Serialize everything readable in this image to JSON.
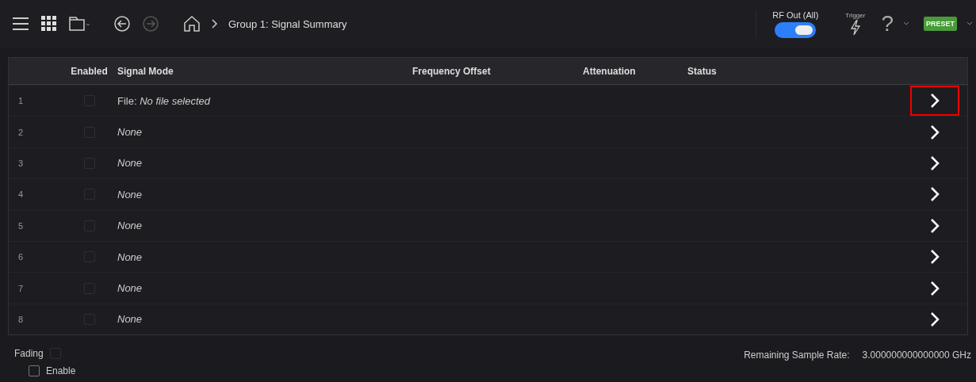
{
  "toolbar": {
    "breadcrumb": "Group 1: Signal Summary",
    "back_disabled": false,
    "forward_disabled": true,
    "rf_out": {
      "label": "RF Out (All)",
      "on": true
    },
    "trigger": {
      "label": "Trigger"
    },
    "help": "?",
    "preset": "PRESET"
  },
  "table": {
    "columns": [
      "Enabled",
      "Signal Mode",
      "Frequency Offset",
      "Attenuation",
      "Status"
    ],
    "rows": [
      {
        "index": "1",
        "enabled": false,
        "mode": "File: *No file selected*",
        "highlighted": true
      },
      {
        "index": "2",
        "enabled": false,
        "mode": "*None*",
        "highlighted": false
      },
      {
        "index": "3",
        "enabled": false,
        "mode": "*None*",
        "highlighted": false
      },
      {
        "index": "4",
        "enabled": false,
        "mode": "*None*",
        "highlighted": false
      },
      {
        "index": "5",
        "enabled": false,
        "mode": "*None*",
        "highlighted": false
      },
      {
        "index": "6",
        "enabled": false,
        "mode": "*None*",
        "highlighted": false
      },
      {
        "index": "7",
        "enabled": false,
        "mode": "*None*",
        "highlighted": false
      },
      {
        "index": "8",
        "enabled": false,
        "mode": "*None*",
        "highlighted": false
      }
    ]
  },
  "fading": {
    "label": "Fading",
    "enable_label": "Enable",
    "enabled": false
  },
  "sample_rate": {
    "label": "Remaining Sample Rate:",
    "value": "3.000000000000000 GHz"
  }
}
